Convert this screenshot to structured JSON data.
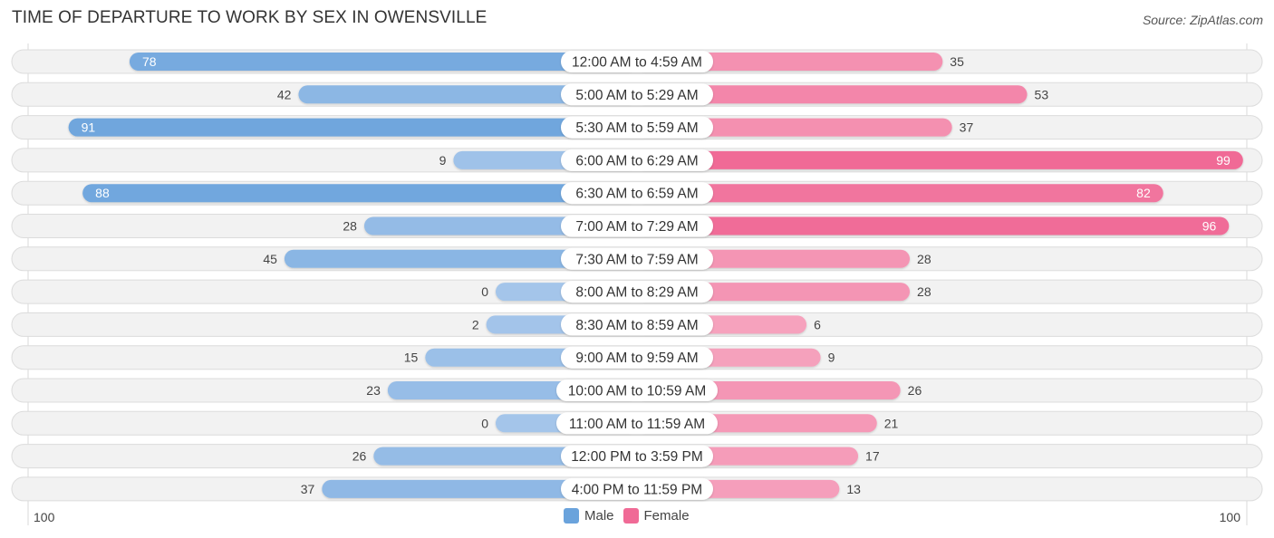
{
  "header": {
    "title": "TIME OF DEPARTURE TO WORK BY SEX IN OWENSVILLE",
    "source": "Source: ZipAtlas.com"
  },
  "colors": {
    "male": "#6aa3dc",
    "male_light": "#a4c5ea",
    "female": "#f06a96",
    "female_light": "#f6a6c0",
    "track": "#f2f2f2"
  },
  "chart_data": {
    "type": "bar",
    "orientation": "horizontal-diverging",
    "title": "TIME OF DEPARTURE TO WORK BY SEX IN OWENSVILLE",
    "categories": [
      "12:00 AM to 4:59 AM",
      "5:00 AM to 5:29 AM",
      "5:30 AM to 5:59 AM",
      "6:00 AM to 6:29 AM",
      "6:30 AM to 6:59 AM",
      "7:00 AM to 7:29 AM",
      "7:30 AM to 7:59 AM",
      "8:00 AM to 8:29 AM",
      "8:30 AM to 8:59 AM",
      "9:00 AM to 9:59 AM",
      "10:00 AM to 10:59 AM",
      "11:00 AM to 11:59 AM",
      "12:00 PM to 3:59 PM",
      "4:00 PM to 11:59 PM"
    ],
    "series": [
      {
        "name": "Male",
        "side": "left",
        "values": [
          78,
          42,
          91,
          9,
          88,
          28,
          45,
          0,
          2,
          15,
          23,
          0,
          26,
          37
        ]
      },
      {
        "name": "Female",
        "side": "right",
        "values": [
          35,
          53,
          37,
          99,
          82,
          96,
          28,
          28,
          6,
          9,
          26,
          21,
          17,
          13
        ]
      }
    ],
    "axis": {
      "left_label": "100",
      "right_label": "100",
      "max": 100
    },
    "legend": {
      "position": "bottom-center",
      "entries": [
        "Male",
        "Female"
      ]
    },
    "grid": false
  }
}
